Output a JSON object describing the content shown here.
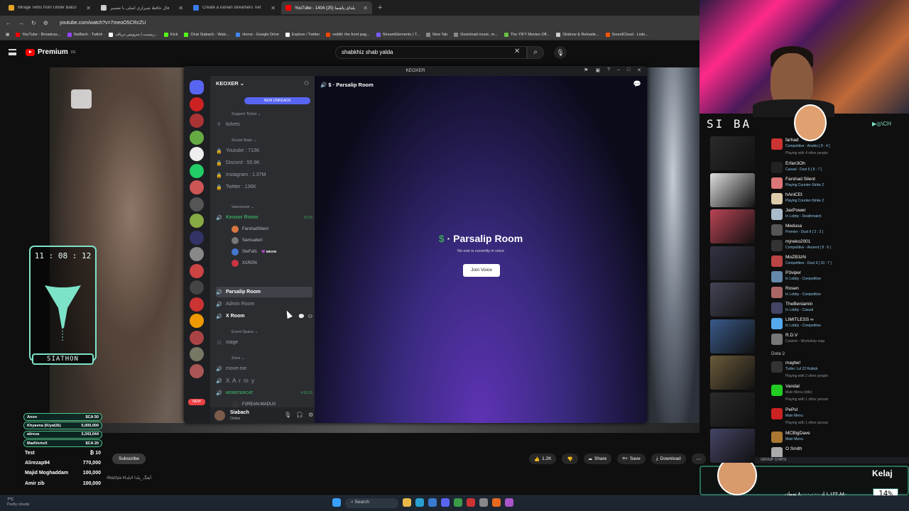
{
  "browser": {
    "tabs": [
      {
        "label": "Mirage Tetris from Under Balco",
        "color": "#e2a52a",
        "active": false
      },
      {
        "label": "فال حافظ شیرازی اصلی با تفسیر",
        "color": "#cccccc",
        "active": false
      },
      {
        "label": "Create a iranian streamers Tier",
        "color": "#3b7de8",
        "active": false
      },
      {
        "label": "YouTube - 1404 یلدای پاشما (25)",
        "color": "#ff0000",
        "active": true
      }
    ],
    "new_tab": "+",
    "url": "youtube.com/watch?v=7meoO5CRcZU",
    "bookmarks": [
      {
        "label": "YouTube - Broadcas...",
        "color": "#ff0000"
      },
      {
        "label": "SiaBach - Twitch",
        "color": "#9146ff"
      },
      {
        "label": "ریسیت | سرویس دریاف...",
        "color": "#ffffff"
      },
      {
        "label": "Kick",
        "color": "#53fc18"
      },
      {
        "label": "Chat Siabach - Watc...",
        "color": "#53fc18"
      },
      {
        "label": "Home - Google Drive",
        "color": "#4285f4"
      },
      {
        "label": "Explore / Twitter",
        "color": "#ffffff"
      },
      {
        "label": "reddit: the front pag...",
        "color": "#ff4500"
      },
      {
        "label": "StreamElements | T...",
        "color": "#7b5cff"
      },
      {
        "label": "New Tab",
        "color": "#888888"
      },
      {
        "label": "Download music, m...",
        "color": "#888888"
      },
      {
        "label": "The YIFY Movies Off...",
        "color": "#6ac045"
      },
      {
        "label": "Skidrow & Reloade...",
        "color": "#cccccc"
      },
      {
        "label": "SoundCloud - Liste...",
        "color": "#ff5500"
      }
    ]
  },
  "youtube": {
    "brand": "Premium",
    "brand_sup": "DE",
    "search_query": "shabkhiz shab yalda",
    "subscribe": "Subscribe",
    "hashtag": "#baziya #آهنگ_یلدا #یلدا",
    "actions": [
      {
        "icon": "like-icon",
        "label": "1.2K"
      },
      {
        "icon": "dislike-icon",
        "label": ""
      },
      {
        "icon": "share-icon",
        "label": "Share"
      },
      {
        "icon": "save-icon",
        "label": "Save"
      },
      {
        "icon": "download-icon",
        "label": "Download"
      }
    ]
  },
  "clock": {
    "time": "11 : 08 : 12",
    "label": "SIATHON"
  },
  "donors": [
    {
      "name": "Anon",
      "amount": "$CA 50"
    },
    {
      "name": "Khyavna (Kiyat2k)",
      "amount": "5,000,000"
    },
    {
      "name": "alireza",
      "amount": "3,343,044"
    },
    {
      "name": "MadVortoX",
      "amount": "$CA 20"
    },
    {
      "name": "Test",
      "amount": "₿ 10"
    },
    {
      "name": "Alirezap94",
      "amount": "770,000"
    },
    {
      "name": "Majid Moghaddam",
      "amount": "100,000"
    },
    {
      "name": "Amir zib",
      "amount": "100,000"
    }
  ],
  "discord": {
    "window_title": "KEOXER",
    "server_name": "KEOXER",
    "new_unreads": "NEW UNREADS",
    "categories": {
      "support": "Support Ticket",
      "social": "Social Stats",
      "vancouver": "Vancouver",
      "event": "Event Space",
      "zone": "Zone"
    },
    "channels": {
      "tickets": "tickets",
      "youtube": "Youtube : 713K",
      "discord": "Discord : 55.9K",
      "instagram": "Instagram : 1.37M",
      "twitter": "Twitter : 136K",
      "keoxer_room": "Keoxer Room",
      "keoxer_time": "10:15",
      "parsalip": "Parsalip Room",
      "admin": "Admin Room",
      "xroom": "X Room",
      "stage": "stage",
      "moveme": "move-me",
      "xarmy": "X A r m y",
      "monstercat": "MONSTERCAT",
      "monstercat_time": "4:53:15",
      "last_user": "F2REAN-MADUX"
    },
    "voice_users": [
      {
        "name": "FarshadSilent",
        "color": "#d97742"
      },
      {
        "name": "Samsaberi",
        "color": "#777777"
      },
      {
        "name": "SteFaN.",
        "color": "#4477cc",
        "tag": "MEOW"
      },
      {
        "name": "X1RON",
        "color": "#cc3344"
      }
    ],
    "user": {
      "name": "Siabach",
      "status": "Online"
    },
    "stage": {
      "header": "Parsalip Room",
      "title": "Parsalip Room",
      "subtitle": "No one is currently in voice",
      "join": "Join Voice"
    },
    "guild_badge_new": "NEW"
  },
  "stream": {
    "logo": "SI BA",
    "social": "▶◎\\CH"
  },
  "friends": [
    {
      "name": "farhad",
      "status": "Competitive - Anubis [ 8 : 4 ]",
      "color": "#c33"
    },
    {
      "more": "Playing with 4 other people"
    },
    {
      "name": "Erfan3Oh",
      "status": "Casual - Dust II [ 8 : 7 ]",
      "color": "#222"
    },
    {
      "name": "Farshad Silent",
      "status": "Playing Counter-Strike 2",
      "color": "#d77"
    },
    {
      "name": "hAniCEt",
      "status": "Playing Counter-Strike 2",
      "color": "#dca"
    },
    {
      "name": "JaxPower",
      "status": "In Lobby - Deathmatch",
      "color": "#abc"
    },
    {
      "name": "Medusa",
      "status": "Premier - Dust II [ 2 : 2 ]",
      "color": "#555"
    },
    {
      "name": "mjneko2001",
      "status": "Competitive - Ancient [ 8 : 6 ]",
      "color": "#333"
    },
    {
      "name": "MoZB3zN",
      "status": "Competitive - Dust II [ 10 : 7 ]",
      "color": "#b44"
    },
    {
      "name": "P3viper",
      "status": "In Lobby - Competitive",
      "color": "#68a"
    },
    {
      "name": "Rosen",
      "status": "In Lobby - Competitive",
      "color": "#a66"
    },
    {
      "name": "TheBeniamin",
      "status": "In Lobby - Casual",
      "color": "#446"
    },
    {
      "name": "LIMITLESS ∞",
      "status": "In Lobby - Competitive",
      "color": "#5ae"
    },
    {
      "name": "R.D.V",
      "status": "Custom - Workshop map",
      "color": "#777",
      "gray": true
    },
    {
      "header": "Dota 2"
    },
    {
      "name": "maybe!",
      "status": "Turbo: Lvl 22 Rubick",
      "color": "#333"
    },
    {
      "more": "Playing with 2 other people"
    },
    {
      "name": "Vandal",
      "status": "Main Menu (Idle)",
      "color": "#2c2",
      "gray": true
    },
    {
      "more": "Playing with 1 other person"
    },
    {
      "name": "PePsI",
      "status": "Main Menu",
      "color": "#c22"
    },
    {
      "more": "Playing with 1 other person"
    },
    {
      "name": "MCBigDave",
      "status": "Main Menu",
      "color": "#a73"
    },
    {
      "name": "O Smith",
      "status": "",
      "color": "#aaa"
    }
  ],
  "group_chats": "GROUP CHATS",
  "banner": {
    "name": "Kelaj",
    "text": "۱,۱۲۲,۸۸۰ از ۸,۰۰۰,۰۰۰ تومان",
    "percent": "14%",
    "progress": 0.14
  },
  "taskbar": {
    "weather_temp": "7°C",
    "weather_desc": "Partly cloudy",
    "search": "Search"
  }
}
